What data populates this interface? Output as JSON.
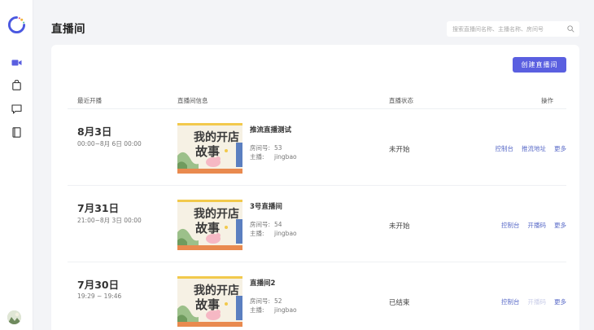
{
  "page_title": "直播间",
  "search": {
    "placeholder": "搜索直播间名称、主播名称、房间号"
  },
  "toolbar": {
    "create_label": "创建直播间"
  },
  "table": {
    "headers": {
      "recent": "最近开播",
      "info": "直播间信息",
      "status": "直播状态",
      "ops": "操作"
    },
    "meta_labels": {
      "room_no": "房间号:",
      "host": "主播:"
    },
    "rows": [
      {
        "date": "8月3日",
        "time_range": "00:00~8月 6日 00:00",
        "name": "推流直播测试",
        "room_no": "53",
        "host": "jingbao",
        "status": "未开始",
        "ops": [
          {
            "label": "控制台",
            "enabled": true
          },
          {
            "label": "推流地址",
            "enabled": true
          },
          {
            "label": "更多",
            "enabled": true
          }
        ]
      },
      {
        "date": "7月31日",
        "time_range": "21:00~8月 3日 00:00",
        "name": "3号直播间",
        "room_no": "54",
        "host": "jingbao",
        "status": "未开始",
        "ops": [
          {
            "label": "控制台",
            "enabled": true
          },
          {
            "label": "开播码",
            "enabled": true
          },
          {
            "label": "更多",
            "enabled": true
          }
        ]
      },
      {
        "date": "7月30日",
        "time_range": "19:29 ~ 19:46",
        "name": "直播间2",
        "room_no": "52",
        "host": "jingbao",
        "status": "已结束",
        "ops": [
          {
            "label": "控制台",
            "enabled": true
          },
          {
            "label": "开播码",
            "enabled": false
          },
          {
            "label": "更多",
            "enabled": true
          }
        ]
      }
    ]
  },
  "thumbnail": {
    "title_line1": "我的开店",
    "title_line2": "故事"
  },
  "colors": {
    "accent": "#5a5fe0",
    "link": "#5a6bc8",
    "sidebar_active": "#5a5fe0"
  },
  "sidebar": {
    "items": [
      {
        "icon": "video-camera-icon",
        "active": true
      },
      {
        "icon": "shopping-bag-icon",
        "active": false
      },
      {
        "icon": "chat-bubble-icon",
        "active": false
      },
      {
        "icon": "book-icon",
        "active": false
      }
    ]
  }
}
